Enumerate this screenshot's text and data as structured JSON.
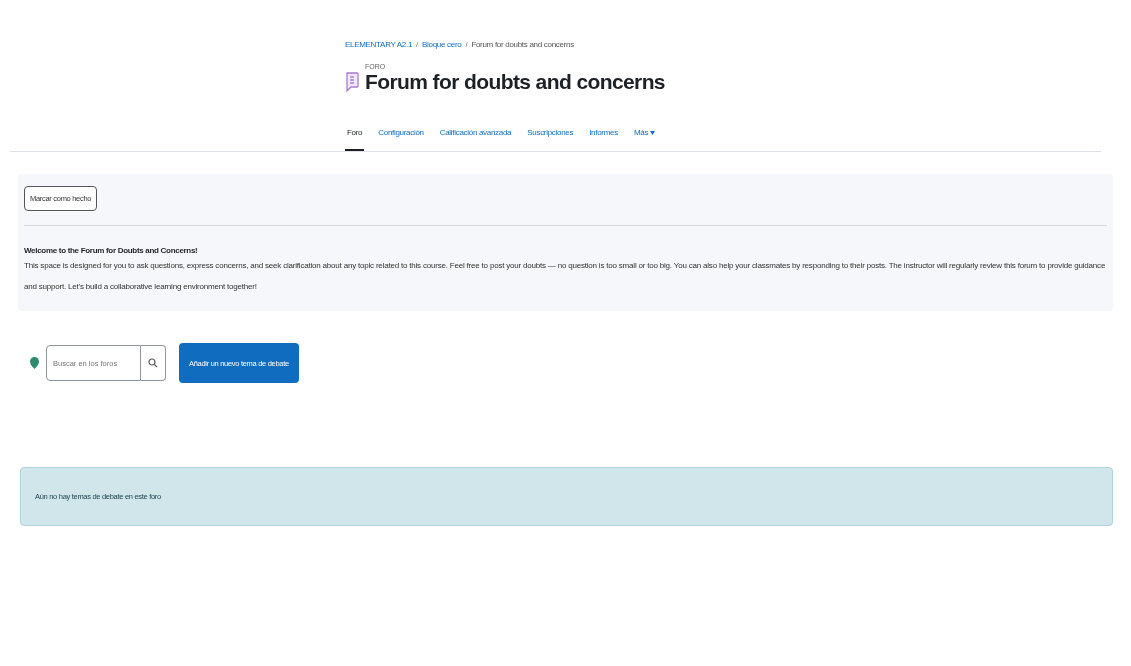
{
  "breadcrumb": {
    "separator": "/",
    "items": [
      "ELEMENTARY A2.1",
      "Bloque cero",
      "Forum for doubts and concerns"
    ]
  },
  "header": {
    "label": "FORO",
    "title": "Forum for doubts and concerns"
  },
  "tabs": [
    {
      "label": "Foro",
      "selected": true
    },
    {
      "label": "Configuración",
      "selected": false
    },
    {
      "label": "Calificación avanzada",
      "selected": false
    },
    {
      "label": "Suscripciones",
      "selected": false
    },
    {
      "label": "Informes",
      "selected": false
    },
    {
      "label": "Más",
      "selected": false,
      "dropdown": true
    }
  ],
  "completion_button": "Marcar como hecho",
  "intro": {
    "heading": "Welcome to the Forum for Doubts and Concerns!",
    "text": "This space is designed for you to ask questions, express concerns, and seek clarification about any topic related to this course. Feel free to post your doubts — no question is too small or too big. You can also help your classmates by responding to their posts. The instructor will regularly review this forum to provide guidance and support. Let's build a collaborative learning environment together!"
  },
  "search": {
    "placeholder": "Buscar en los foros"
  },
  "add_button": "Añadir un nuevo tema de debate",
  "notice": "Aún no hay temas de debate en este foro"
}
